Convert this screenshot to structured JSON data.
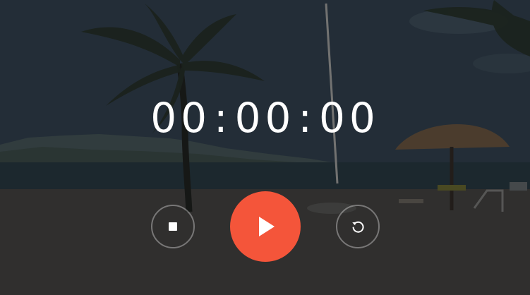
{
  "timer": {
    "hours": "00",
    "minutes": "00",
    "seconds": "00",
    "separator": ":"
  },
  "controls": {
    "stop_icon": "stop-icon",
    "play_icon": "play-icon",
    "reset_icon": "reset-icon"
  },
  "colors": {
    "accent": "#f4553a",
    "text": "#ffffff"
  }
}
